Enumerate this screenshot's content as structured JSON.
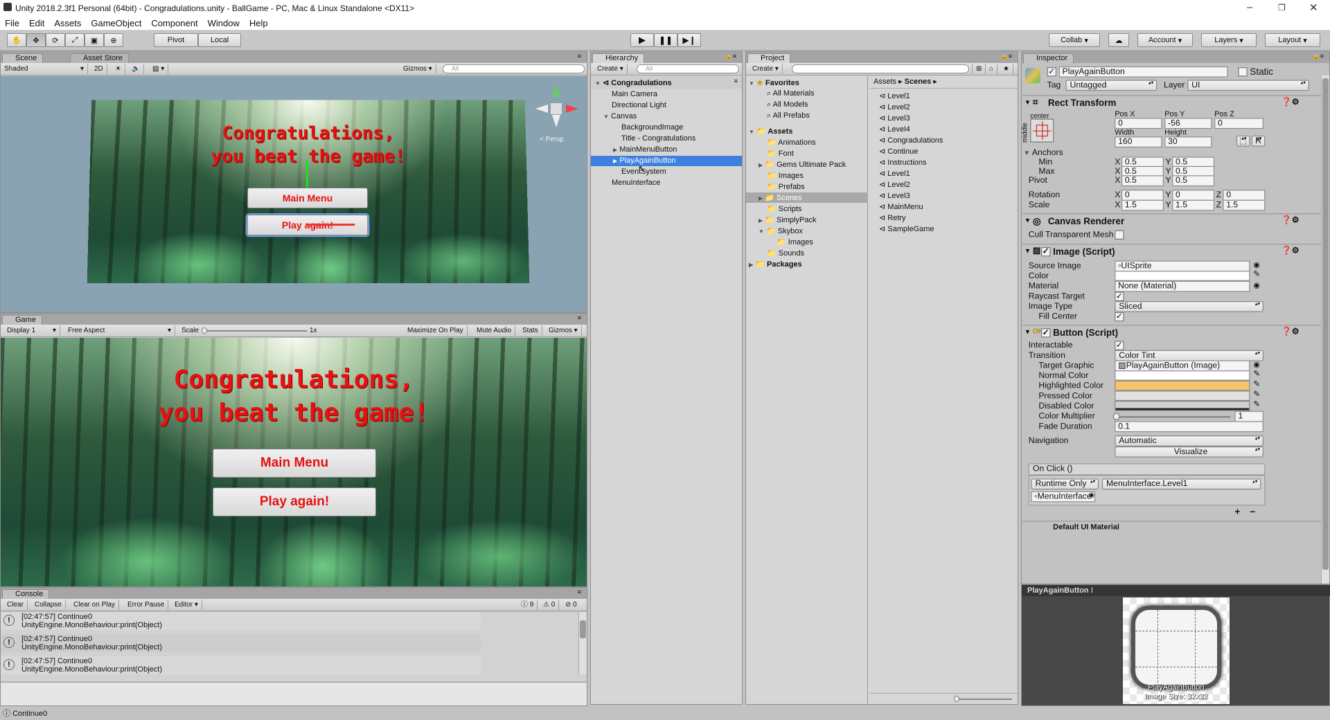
{
  "window": {
    "title": "Unity 2018.2.3f1 Personal (64bit) - Congradulations.unity - BallGame - PC, Mac & Linux Standalone <DX11>"
  },
  "menu": [
    "File",
    "Edit",
    "Assets",
    "GameObject",
    "Component",
    "Window",
    "Help"
  ],
  "toolbar": {
    "pivot": "Pivot",
    "local": "Local",
    "collab": "Collab",
    "account": "Account",
    "layers": "Layers",
    "layout": "Layout"
  },
  "scene": {
    "tab": "Scene",
    "tab2": "Asset Store",
    "shading": "Shaded",
    "mode2d": "2D",
    "gizmos": "Gizmos",
    "search_placeholder": "All",
    "persp": "Persp",
    "congrats_line1": "Congratulations,",
    "congrats_line2": "you beat the game!",
    "btn_main": "Main Menu",
    "btn_play": "Play again!"
  },
  "game": {
    "tab": "Game",
    "display": "Display 1",
    "aspect": "Free Aspect",
    "scale_label": "Scale",
    "scale_value": "1x",
    "maximize": "Maximize On Play",
    "mute": "Mute Audio",
    "stats": "Stats",
    "gizmos": "Gizmos",
    "congrats_line1": "Congratulations,",
    "congrats_line2": "you beat the game!",
    "btn_main": "Main Menu",
    "btn_play": "Play again!"
  },
  "console": {
    "tab": "Console",
    "clear": "Clear",
    "collapse": "Collapse",
    "clear_on_play": "Clear on Play",
    "error_pause": "Error Pause",
    "editor": "Editor",
    "count_log": "9",
    "count_warn": "0",
    "count_err": "0",
    "rows": [
      {
        "line1": "[02:47:57] Continue0",
        "line2": "UnityEngine.MonoBehaviour:print(Object)"
      },
      {
        "line1": "[02:47:57] Continue0",
        "line2": "UnityEngine.MonoBehaviour:print(Object)"
      },
      {
        "line1": "[02:47:57] Continue0",
        "line2": "UnityEngine.MonoBehaviour:print(Object)"
      }
    ]
  },
  "statusbar": {
    "text": "Continue0"
  },
  "hierarchy": {
    "tab": "Hierarchy",
    "create": "Create",
    "search_placeholder": "All",
    "scene": "Congradulations",
    "items": [
      "Main Camera",
      "Directional Light",
      "Canvas",
      "BackgroundImage",
      "Title - Congratulations",
      "MainMenuButton",
      "PlayAgainButton",
      "EventSystem",
      "MenuInterface"
    ]
  },
  "project": {
    "tab": "Project",
    "create": "Create",
    "favorites": "Favorites",
    "fav_items": [
      "All Materials",
      "All Models",
      "All Prefabs"
    ],
    "assets": "Assets",
    "asset_folders": [
      "Animations",
      "Font",
      "Gems Ultimate Pack",
      "Images",
      "Prefabs",
      "Scenes",
      "Scripts",
      "SimplyPack",
      "Skybox",
      "Images",
      "Sounds"
    ],
    "packages": "Packages",
    "breadcrumb_root": "Assets",
    "breadcrumb_current": "Scenes",
    "scenes": [
      "Level1",
      "Level2",
      "Level3",
      "Level4",
      "Congradulations",
      "Continue",
      "Instructions",
      "Level1",
      "Level2",
      "Level3",
      "MainMenu",
      "Retry",
      "SampleGame"
    ]
  },
  "inspector": {
    "tab": "Inspector",
    "object_name": "PlayAgainButton",
    "static": "Static",
    "tag_label": "Tag",
    "tag": "Untagged",
    "layer_label": "Layer",
    "layer": "UI",
    "rect_transform": "Rect Transform",
    "anchor_h": "center",
    "anchor_v": "middle",
    "posx_label": "Pos X",
    "posy_label": "Pos Y",
    "posz_label": "Pos Z",
    "posx": "0",
    "posy": "-56",
    "posz": "0",
    "width_label": "Width",
    "height_label": "Height",
    "width": "160",
    "height": "30",
    "anchors": "Anchors",
    "min": "Min",
    "max": "Max",
    "pivot": "Pivot",
    "min_x": "0.5",
    "min_y": "0.5",
    "max_x": "0.5",
    "max_y": "0.5",
    "pivot_x": "0.5",
    "pivot_y": "0.5",
    "rotation": "Rotation",
    "rot_x": "0",
    "rot_y": "0",
    "rot_z": "0",
    "scale": "Scale",
    "scale_x": "1.5",
    "scale_y": "1.5",
    "scale_z": "1.5",
    "canvas_renderer": "Canvas Renderer",
    "cull": "Cull Transparent Mesh",
    "image_script": "Image (Script)",
    "source_image_label": "Source Image",
    "source_image": "UISprite",
    "color_label": "Color",
    "material_label": "Material",
    "material": "None (Material)",
    "raycast_label": "Raycast Target",
    "image_type_label": "Image Type",
    "image_type": "Sliced",
    "fill_center_label": "Fill Center",
    "button_script": "Button (Script)",
    "interactable_label": "Interactable",
    "transition_label": "Transition",
    "transition": "Color Tint",
    "target_graphic_label": "Target Graphic",
    "target_graphic": "PlayAgainButton (Image)",
    "normal_color_label": "Normal Color",
    "highlighted_color_label": "Highlighted Color",
    "pressed_color_label": "Pressed Color",
    "disabled_color_label": "Disabled Color",
    "color_mult_label": "Color Multiplier",
    "color_mult": "1",
    "fade_label": "Fade Duration",
    "fade": "0.1",
    "navigation_label": "Navigation",
    "navigation": "Automatic",
    "visualize": "Visualize",
    "onclick": "On Click ()",
    "runtime": "Runtime Only",
    "function": "MenuInterface.Level1",
    "target_obj": "MenuInterface",
    "plus": "+",
    "minus": "−",
    "next_comp": "Default UI Material"
  },
  "preview": {
    "title": "PlayAgainButton",
    "caption1": "PlayAgainButton",
    "caption2": "Image Size: 32x32"
  },
  "colors": {
    "highlight": "#3d80df",
    "highlighted_color": "#f5c56a",
    "accent_red": "#e81010"
  }
}
